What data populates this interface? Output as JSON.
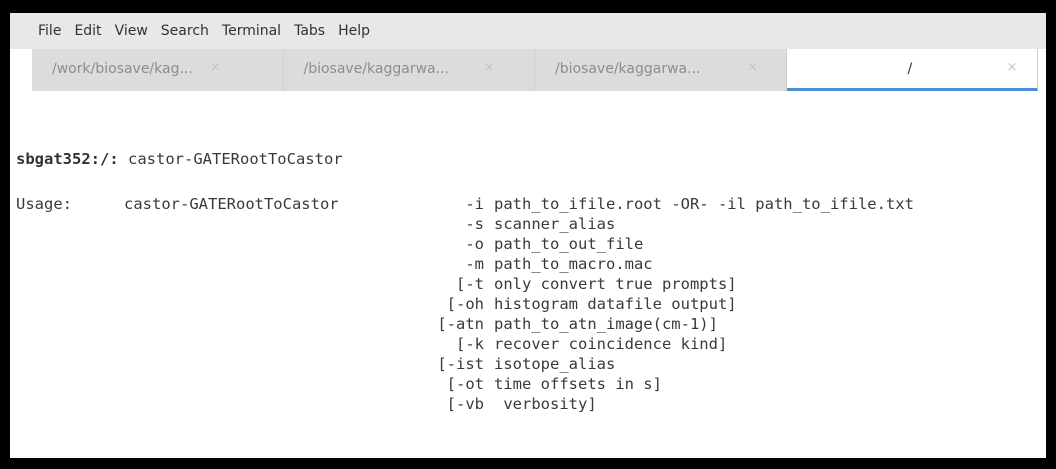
{
  "menubar": {
    "items": [
      "File",
      "Edit",
      "View",
      "Search",
      "Terminal",
      "Tabs",
      "Help"
    ]
  },
  "tabs": [
    {
      "label": "/work/biosave/kag...",
      "close": "×"
    },
    {
      "label": "/biosave/kaggarwa...",
      "close": "×"
    },
    {
      "label": "/biosave/kaggarwa...",
      "close": "×"
    },
    {
      "label": "/",
      "close": "×"
    }
  ],
  "active_tab": 3,
  "terminal": {
    "prompt": "sbgat352:/:",
    "command": "castor-GATERootToCastor",
    "usage_label": "Usage:",
    "usage_command": "castor-GATERootToCastor",
    "options": [
      {
        "flag": "-i",
        "desc": "path_to_ifile.root -OR- -il path_to_ifile.txt"
      },
      {
        "flag": "-s",
        "desc": "scanner_alias"
      },
      {
        "flag": "-o",
        "desc": "path_to_out_file"
      },
      {
        "flag": "-m",
        "desc": "path_to_macro.mac"
      },
      {
        "flag": "[-t",
        "desc": "only convert true prompts]"
      },
      {
        "flag": "[-oh",
        "desc": "histogram datafile output]"
      },
      {
        "flag": "[-atn",
        "desc": "path_to_atn_image(cm-1)]"
      },
      {
        "flag": "[-k",
        "desc": "recover coincidence kind]"
      },
      {
        "flag": "[-ist",
        "desc": "isotope_alias"
      },
      {
        "flag": "[-ot",
        "desc": "time offsets in s]"
      },
      {
        "flag": "[-vb",
        "desc": " verbosity]"
      }
    ]
  },
  "colors": {
    "tab_active_underline": "#4a90d9",
    "menubar_bg": "#e8e8e7",
    "terminal_text": "#3a3a3a"
  }
}
